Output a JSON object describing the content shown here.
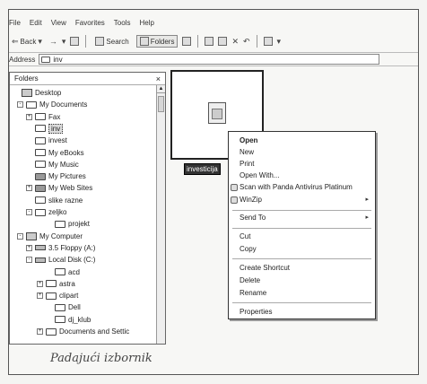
{
  "menubar": [
    "File",
    "Edit",
    "View",
    "Favorites",
    "Tools",
    "Help"
  ],
  "toolbar": {
    "back_label": "Back",
    "search_label": "Search",
    "folders_label": "Folders"
  },
  "address": {
    "label": "Address",
    "value": "inv"
  },
  "folders_pane": {
    "title": "Folders",
    "close_glyph": "×",
    "tree": [
      {
        "label": "Desktop",
        "icon": "desktop-icon"
      },
      {
        "label": "My Documents",
        "icon": "folder-icon",
        "expander": "-"
      },
      {
        "label": "Fax",
        "icon": "folder-icon",
        "expander": "+"
      },
      {
        "label": "inv",
        "icon": "folder-icon",
        "selected": true
      },
      {
        "label": "invest",
        "icon": "folder-icon"
      },
      {
        "label": "My eBooks",
        "icon": "folder-icon"
      },
      {
        "label": "My Music",
        "icon": "folder-icon"
      },
      {
        "label": "My Pictures",
        "icon": "folder-icon"
      },
      {
        "label": "My Web Sites",
        "icon": "folder-icon",
        "expander": "+"
      },
      {
        "label": "slike razne",
        "icon": "folder-icon"
      },
      {
        "label": "zeljko",
        "icon": "folder-icon",
        "expander": "-"
      },
      {
        "label": "projekt",
        "icon": "folder-icon"
      },
      {
        "label": "My Computer",
        "icon": "computer-icon",
        "expander": "-"
      },
      {
        "label": "3.5 Floppy (A:)",
        "icon": "floppy-icon",
        "expander": "+"
      },
      {
        "label": "Local Disk (C:)",
        "icon": "drive-icon",
        "expander": "-"
      },
      {
        "label": "acd",
        "icon": "folder-icon"
      },
      {
        "label": "astra",
        "icon": "folder-icon",
        "expander": "+"
      },
      {
        "label": "clipart",
        "icon": "folder-icon",
        "expander": "+"
      },
      {
        "label": "Dell",
        "icon": "folder-icon"
      },
      {
        "label": "dj_klub",
        "icon": "folder-icon"
      },
      {
        "label": "Documents and Settic",
        "icon": "folder-icon",
        "expander": "+"
      }
    ]
  },
  "file": {
    "label": "investicija",
    "icon": "document-icon"
  },
  "context_menu": {
    "items": [
      {
        "label": "Open",
        "bold": true
      },
      {
        "label": "New"
      },
      {
        "label": "Print"
      },
      {
        "label": "Open With..."
      },
      {
        "label": "Scan with Panda Antivirus Platinum",
        "icon": "panda-icon"
      },
      {
        "label": "WinZip",
        "icon": "winzip-icon",
        "submenu": true
      },
      {
        "label": "Send To",
        "submenu": true
      },
      {
        "label": "Cut"
      },
      {
        "label": "Copy"
      },
      {
        "label": "Create Shortcut"
      },
      {
        "label": "Delete"
      },
      {
        "label": "Rename"
      },
      {
        "label": "Properties"
      }
    ],
    "submenu_glyph": "▸"
  },
  "caption": "Padajući izbornik"
}
